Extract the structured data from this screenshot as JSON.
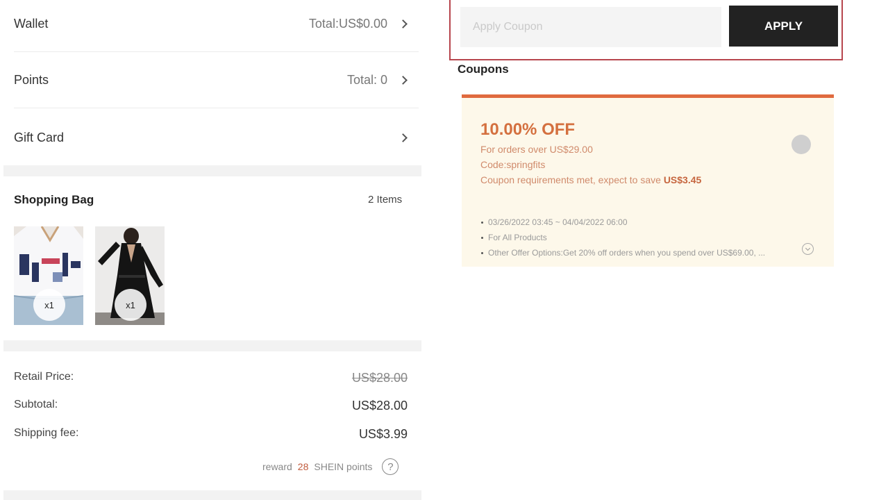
{
  "payment_options": {
    "wallet": {
      "label": "Wallet",
      "value": "Total:US$0.00"
    },
    "points": {
      "label": "Points",
      "value": "Total: 0"
    },
    "gift_card": {
      "label": "Gift Card"
    }
  },
  "shopping_bag": {
    "title": "Shopping Bag",
    "count": "2 Items",
    "items": [
      {
        "qty": "x1"
      },
      {
        "qty": "x1"
      }
    ]
  },
  "summary": {
    "retail_price_label": "Retail Price:",
    "retail_price_value": "US$28.00",
    "subtotal_label": "Subtotal:",
    "subtotal_value": "US$28.00",
    "shipping_label": "Shipping fee:",
    "shipping_value": "US$3.99",
    "reward_prefix": "reward",
    "reward_points": "28",
    "reward_suffix": "SHEIN points",
    "help_icon": "?"
  },
  "coupon_entry": {
    "placeholder": "Apply Coupon",
    "apply_label": "APPLY"
  },
  "coupons": {
    "title": "Coupons",
    "card": {
      "discount": "10.00% OFF",
      "condition": "For orders over US$29.00",
      "code": "Code:springfits",
      "status_text": "Coupon requirements met, expect to save",
      "save_amount": "US$3.45",
      "details": [
        "03/26/2022  03:45 ~ 04/04/2022  06:00",
        "For All Products",
        "Other Offer Options:Get 20% off orders when you spend over US$69.00, ..."
      ]
    }
  },
  "colors": {
    "accent_orange": "#e06a3f",
    "highlight_border": "#b7454d",
    "button_dark": "#222222"
  }
}
